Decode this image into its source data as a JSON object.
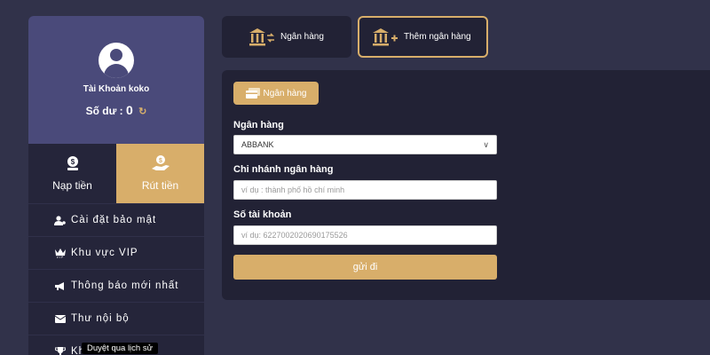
{
  "profile": {
    "account_name": "Tài Khoản koko",
    "balance_label": "Số dư :",
    "balance_value": "0"
  },
  "sidebar": {
    "deposit_label": "Nạp tiền",
    "withdraw_label": "Rút tiền",
    "items": [
      {
        "label": "Cài đặt bảo mật",
        "icon": "user-gear-icon"
      },
      {
        "label": "Khu vực VIP",
        "icon": "vip-crown-icon"
      },
      {
        "label": "Thông báo mới nhất",
        "icon": "megaphone-icon"
      },
      {
        "label": "Thư nội bộ",
        "icon": "envelope-icon"
      },
      {
        "label": "Kh",
        "icon": "trophy-icon"
      }
    ]
  },
  "tooltip": "Duyệt qua lịch sử",
  "top_tabs": {
    "bank": "Ngân hàng",
    "add_bank": "Thêm ngân hàng"
  },
  "form": {
    "pill_label": "Ngân hàng",
    "bank_label": "Ngân hàng",
    "bank_value": "ABBANK",
    "branch_label": "Chi nhánh ngân hàng",
    "branch_placeholder": "ví dụ : thành phố hồ chí minh",
    "account_label": "Số tài khoản",
    "account_placeholder": "ví dụ:  6227002020690175526",
    "submit_label": "gửi đi"
  },
  "colors": {
    "accent": "#d8ae6a",
    "background": "#31324a",
    "panel": "#222235",
    "profile": "#4a4a7a"
  }
}
